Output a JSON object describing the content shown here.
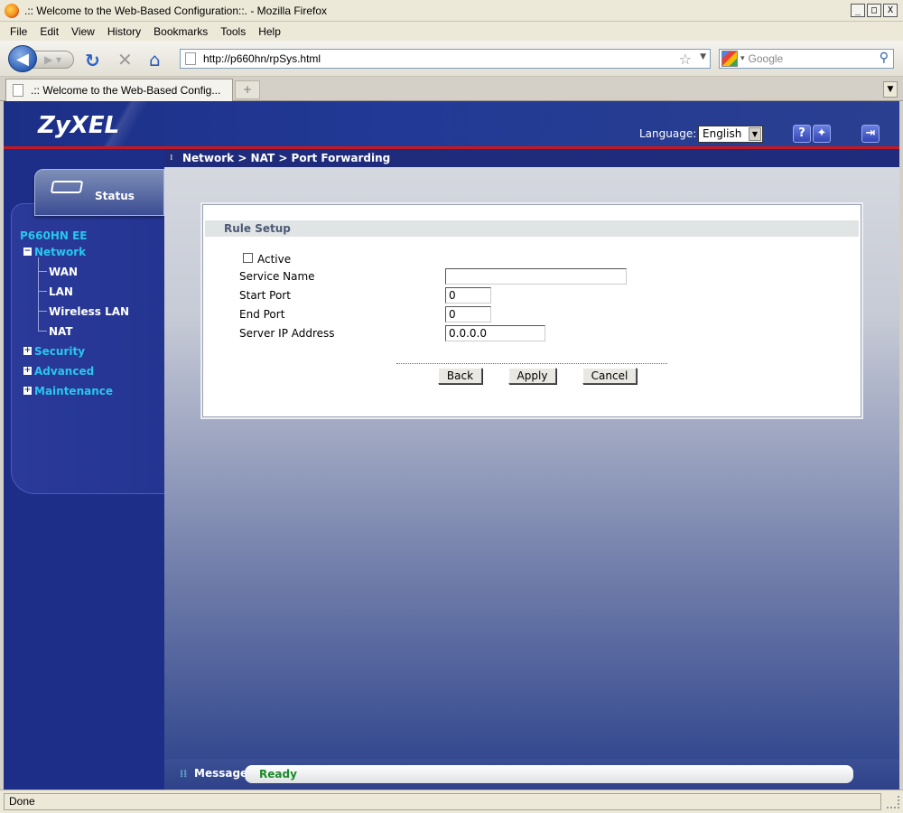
{
  "window": {
    "title": ".:: Welcome to the Web-Based Configuration::. - Mozilla Firefox",
    "minimize": "_",
    "maximize": "□",
    "close": "X"
  },
  "menu": [
    "File",
    "Edit",
    "View",
    "History",
    "Bookmarks",
    "Tools",
    "Help"
  ],
  "toolbar": {
    "url": "http://p660hn/rpSys.html",
    "search_placeholder": "Google"
  },
  "tab": {
    "label": ".:: Welcome to the Web-Based Config..."
  },
  "header": {
    "logo": "ZyXEL",
    "language_label": "Language:",
    "language_value": "English",
    "help_icon": "?",
    "wizard_icon": "✦",
    "logout_icon": "⇥"
  },
  "sidebar": {
    "status_label": "Status",
    "model": "P660HN EE",
    "network": "Network",
    "network_items": [
      "WAN",
      "LAN",
      "Wireless LAN",
      "NAT"
    ],
    "security": "Security",
    "advanced": "Advanced",
    "maintenance": "Maintenance"
  },
  "breadcrumb": "Network > NAT > Port Forwarding",
  "form": {
    "section_title": "Rule Setup",
    "active_label": "Active",
    "active_checked": false,
    "service_name_label": "Service Name",
    "service_name_value": "",
    "start_port_label": "Start Port",
    "start_port_value": "0",
    "end_port_label": "End Port",
    "end_port_value": "0",
    "server_ip_label": "Server IP Address",
    "server_ip_value": "0.0.0.0",
    "back_label": "Back",
    "apply_label": "Apply",
    "cancel_label": "Cancel"
  },
  "message": {
    "label": "Message",
    "status": "Ready"
  },
  "statusbar": {
    "text": "Done"
  }
}
